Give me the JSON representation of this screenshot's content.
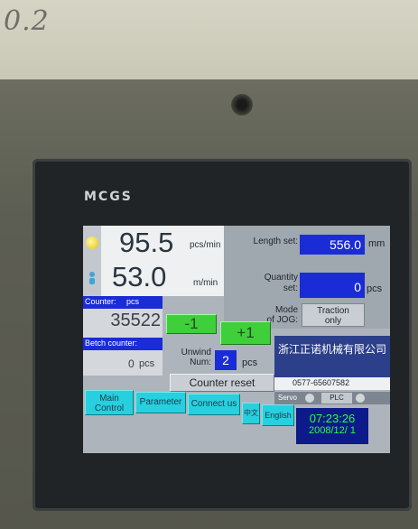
{
  "photo": {
    "handwritten_note": "0.2",
    "brand": "MCGS"
  },
  "hmi": {
    "speed": {
      "value": "95.5",
      "unit": "pcs/min"
    },
    "line_speed": {
      "value": "53.0",
      "unit": "m/min"
    },
    "length_set": {
      "label": "Length set:",
      "value": "556.0",
      "unit": "mm"
    },
    "quantity_set": {
      "label_line1": "Quantity",
      "label_line2": "set:",
      "value": "0",
      "unit": "pcs"
    },
    "jog_mode": {
      "label_line1": "Mode",
      "label_line2": "of JOG:",
      "value_line1": "Traction",
      "value_line2": "only"
    },
    "counter": {
      "label": "Counter:",
      "unit_label": "pcs",
      "value": "35522"
    },
    "batch_counter": {
      "label": "Betch counter:",
      "value": "0",
      "unit": "pcs"
    },
    "minus_button": "-1",
    "plus_button": "+1",
    "unwind": {
      "label_line1": "Unwind",
      "label_line2": "Num:",
      "value": "2",
      "unit": "pcs"
    },
    "counter_reset": "Counter reset",
    "company": {
      "name": "浙江正诺机械有限公司",
      "phone": "0577-65607582"
    },
    "nav": {
      "main_control_line1": "Main",
      "main_control_line2": "Control",
      "parameter": "Parameter",
      "connect_us": "Connect us",
      "chinese": "中文",
      "english": "English"
    },
    "status": {
      "servo": "Servo",
      "plc": "PLC"
    },
    "clock": {
      "time": "07:23:26",
      "date": "2008/12/ 1"
    }
  },
  "colors": {
    "blue_value": "#1a2cd6",
    "cyan_button": "#27d0de",
    "green_button": "#3ecf3a",
    "clock_green": "#2dff3a"
  }
}
